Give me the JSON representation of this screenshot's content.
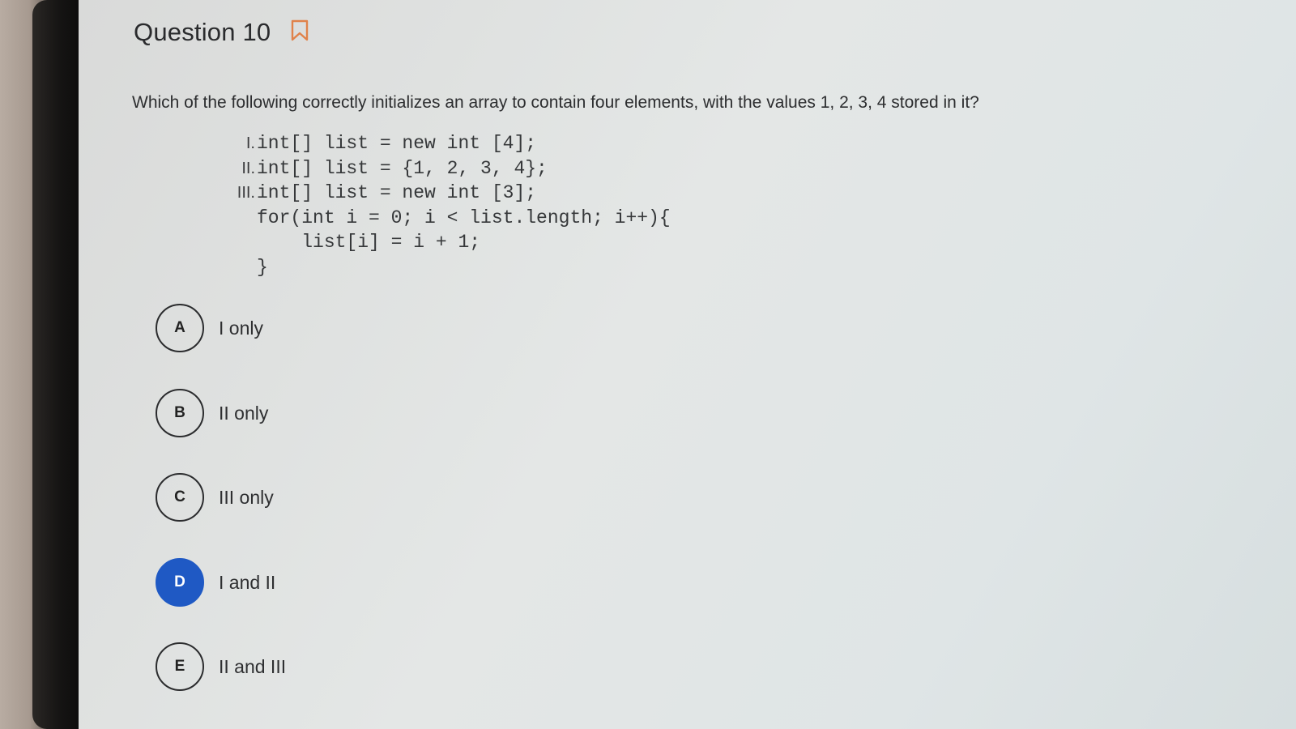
{
  "question": {
    "title": "Question 10",
    "prompt": "Which of the following correctly initializes an array to contain four elements, with the values 1, 2, 3, 4 stored in it?",
    "code_lines": [
      {
        "roman": "I.",
        "code": "int[] list = new int [4];"
      },
      {
        "roman": "II.",
        "code": "int[] list = {1, 2, 3, 4};"
      },
      {
        "roman": "III.",
        "code": "int[] list = new int [3];"
      },
      {
        "roman": "",
        "code": "for(int i = 0; i < list.length; i++){"
      },
      {
        "roman": "",
        "code": "    list[i] = i + 1;"
      },
      {
        "roman": "",
        "code": "}"
      }
    ]
  },
  "choices": [
    {
      "letter": "A",
      "text": "I only",
      "selected": false
    },
    {
      "letter": "B",
      "text": "II only",
      "selected": false
    },
    {
      "letter": "C",
      "text": "III only",
      "selected": false
    },
    {
      "letter": "D",
      "text": "I and II",
      "selected": true
    },
    {
      "letter": "E",
      "text": "II and III",
      "selected": false
    }
  ],
  "icons": {
    "bookmark": "bookmark-icon"
  },
  "colors": {
    "selected": "#1f59c4",
    "bookmark": "#e0824a"
  }
}
